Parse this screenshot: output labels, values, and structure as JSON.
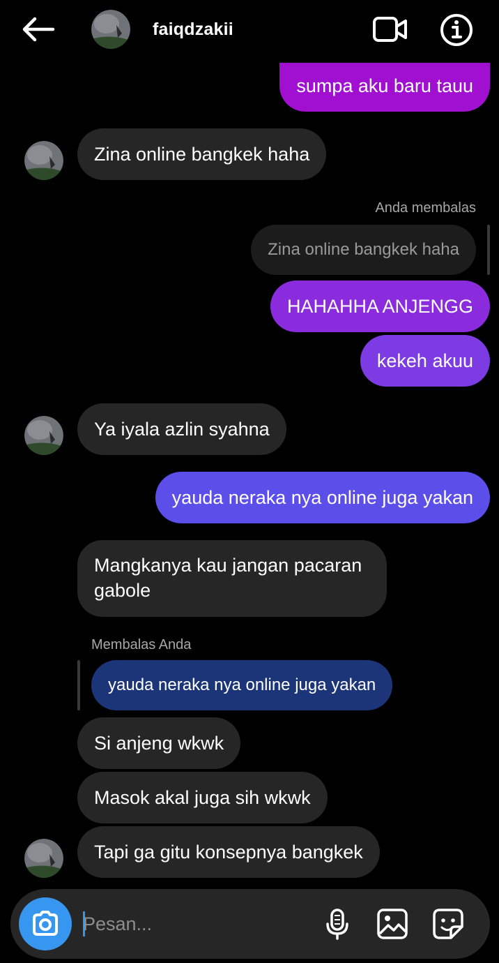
{
  "header": {
    "contact_name": "faiqdzakii"
  },
  "colors": {
    "accent": "#3797f0",
    "incoming_bubble": "#262626",
    "outgoing_gradient": [
      "#a10fd1",
      "#7a3ee6",
      "#5a4fe8",
      "#3a47d8"
    ],
    "quoted_own": "#1c3578"
  },
  "messages": {
    "m1": "sumpa aku baru tauu",
    "m2": "Zina online bangkek haha",
    "m3_label": "Anda membalas",
    "m3_quote": "Zina online bangkek haha",
    "m4": "HAHAHHA ANJENGG",
    "m5": "kekeh akuu",
    "m6": "Ya iyala azlin syahna",
    "m7": "yauda neraka nya online juga yakan",
    "m8": "Mangkanya kau jangan pacaran gabole",
    "m9_label": "Membalas Anda",
    "m9_quote": "yauda neraka nya online juga yakan",
    "m10": "Si anjeng wkwk",
    "m11": "Masok akal juga sih wkwk",
    "m12": "Tapi ga gitu konsepnya bangkek"
  },
  "composer": {
    "placeholder": "Pesan...",
    "value": ""
  },
  "icons": [
    "back-arrow-icon",
    "video-call-icon",
    "info-icon",
    "camera-icon",
    "microphone-icon",
    "gallery-icon",
    "sticker-icon"
  ]
}
